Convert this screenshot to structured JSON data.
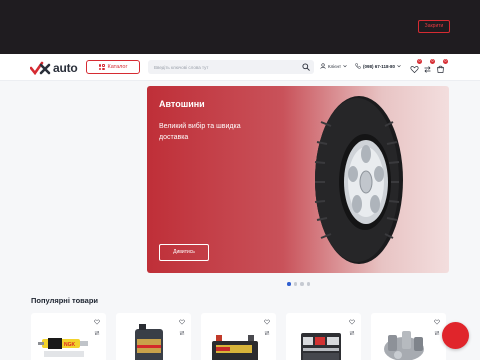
{
  "topbar": {
    "close_label": "Закрити"
  },
  "header": {
    "logo_text": "auto",
    "catalog_label": "Каталог",
    "search_placeholder": "Введіть ключові слова тут",
    "login_label": "Клієнт",
    "phone": "(098) 67-118-80",
    "wishlist_count": "0",
    "compare_count": "0",
    "cart_count": "0"
  },
  "hero": {
    "title": "Автошини",
    "subtitle": "Великий вибір та швидка доставка",
    "button_label": "Дивитись",
    "slides": 4,
    "active_slide": 1
  },
  "popular": {
    "title": "Популярні товари",
    "items": [
      {
        "image": "spark-plug-product"
      },
      {
        "image": "motor-oil-product"
      },
      {
        "image": "car-battery-product"
      },
      {
        "image": "toolbox-product"
      },
      {
        "image": "metal-parts-product"
      }
    ]
  },
  "colors": {
    "brand_red": "#d62b32",
    "topbar": "#1f1c20",
    "active_dot": "#2f5fd0"
  },
  "chat_fab": {
    "icon": "chat-icon"
  }
}
